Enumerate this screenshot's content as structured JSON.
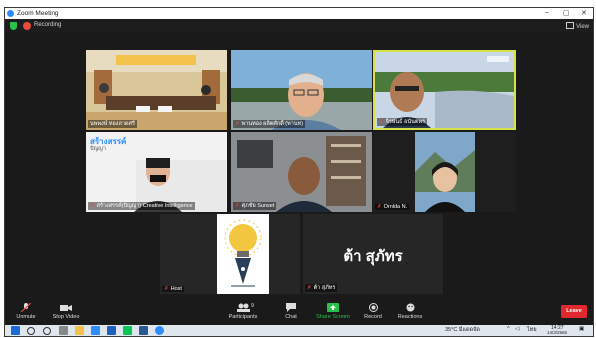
{
  "window": {
    "title": "Zoom Meeting",
    "min": "–",
    "max": "▢",
    "close": "✕"
  },
  "top_bar": {
    "recording": "Recording",
    "view": "View"
  },
  "tiles": [
    {
      "name": "นพพงษ์ ทองลาดศรี",
      "muted": false
    },
    {
      "name": "พานทอง ผลิตศักดิ์ (พานท)",
      "muted": true
    },
    {
      "name": "จิรพันธ์ อนันตพร",
      "muted": true
    },
    {
      "name": "สร้างสรรค์(ปัญญา) Creative Intelligence",
      "muted": true,
      "logo_line1": "สร้างสรรค์",
      "logo_line2": "ปัญญา"
    },
    {
      "name": "ศุภชัย Sunset",
      "muted": true
    },
    {
      "name": "Ornlda N.",
      "muted": true
    },
    {
      "name": "Host",
      "muted": true
    },
    {
      "name": "ต้า สุภัทร",
      "muted": true,
      "display_text": "ต้า สุภัทร"
    }
  ],
  "toolbar": {
    "unmute": "Unmute",
    "stop_video": "Stop Video",
    "participants": "Participants",
    "participants_count": "9",
    "chat": "Chat",
    "share_screen": "Share Screen",
    "record": "Record",
    "reactions": "Reactions",
    "leave": "Leave"
  },
  "taskbar": {
    "weather": "35°C มีแดดจัด",
    "lang": "ไทย",
    "time": "14:27",
    "date": "14/3/2565"
  },
  "colors": {
    "accent": "#2d8cff",
    "record": "#e64b3c",
    "leave": "#e0282e",
    "share": "#27c24c",
    "speaker_border": "#d6e24a"
  }
}
